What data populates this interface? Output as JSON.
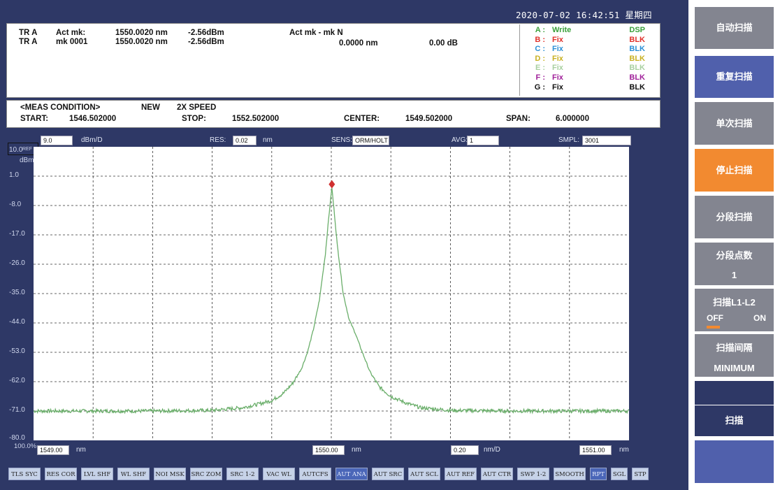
{
  "datetime": "2020-07-02 16:42:51 星期四",
  "markers": {
    "rows": [
      {
        "trace": "TR A",
        "label": "Act mk:",
        "wl": "1550.0020 nm",
        "level": "-2.56dBm"
      },
      {
        "trace": "TR A",
        "label": "mk 0001",
        "wl": "1550.0020 nm",
        "level": "-2.56dBm"
      }
    ],
    "delta_label": "Act mk - mk N",
    "delta_wl": "0.0000 nm",
    "delta_db": "0.00 dB"
  },
  "traces": [
    {
      "key": "A :",
      "mode": "Write",
      "disp": "DSP",
      "color": "#3aa03a"
    },
    {
      "key": "B :",
      "mode": "Fix",
      "disp": "BLK",
      "color": "#e0302a"
    },
    {
      "key": "C :",
      "mode": "Fix",
      "disp": "BLK",
      "color": "#2a8fd6"
    },
    {
      "key": "D :",
      "mode": "Fix",
      "disp": "BLK",
      "color": "#c8b020"
    },
    {
      "key": "E :",
      "mode": "Fix",
      "disp": "BLK",
      "color": "#a8d0a0"
    },
    {
      "key": "F :",
      "mode": "Fix",
      "disp": "BLK",
      "color": "#a0209a"
    },
    {
      "key": "G :",
      "mode": "Fix",
      "disp": "BLK",
      "color": "#111111"
    }
  ],
  "meas": {
    "title": "<MEAS CONDITION>",
    "new": "NEW",
    "speed": "2X SPEED",
    "start_label": "START:",
    "start": "1546.502000",
    "stop_label": "STOP:",
    "stop": "1552.502000",
    "center_label": "CENTER:",
    "center": "1549.502000",
    "span_label": "SPAN:",
    "span": "6.000000"
  },
  "settings": {
    "scale": "9.0",
    "scale_unit": "dBm/D",
    "res_label": "RES:",
    "res": "0.02",
    "res_unit": "nm",
    "sens_label": "SENS:",
    "sens": "ORM/HOLT",
    "avg_label": "AVG:",
    "avg": "1",
    "smpl_label": "SMPL:",
    "smpl": "3001"
  },
  "ref": {
    "value": "10.0",
    "suffix": "REF",
    "unit": "dBm"
  },
  "x_axis": {
    "left": "1549.00",
    "center": "1550.00",
    "right": "1551.00",
    "unit": "nm",
    "div": "0.20",
    "div_unit": "nm/D",
    "pct": "100.0%"
  },
  "chart_data": {
    "type": "line",
    "xlim": [
      1549.0,
      1551.0
    ],
    "ylim": [
      -80.0,
      10.0
    ],
    "grid": true,
    "ytick_labels": [
      "10.0",
      "1.0",
      "-8.0",
      "-17.0",
      "-26.0",
      "-35.0",
      "-44.0",
      "-53.0",
      "-62.0",
      "-71.0",
      "-80.0"
    ],
    "series": [
      {
        "color": "#6aae6a",
        "x": [
          1549.0,
          1549.2,
          1549.4,
          1549.6,
          1549.7,
          1549.75,
          1549.8,
          1549.84,
          1549.87,
          1549.9,
          1549.92,
          1549.94,
          1549.96,
          1549.98,
          1549.99,
          1550.0,
          1550.002,
          1550.01,
          1550.02,
          1550.04,
          1550.06,
          1550.08,
          1550.1,
          1550.13,
          1550.16,
          1550.2,
          1550.25,
          1550.3,
          1550.4,
          1550.6,
          1550.8,
          1551.0
        ],
        "y": [
          -71.0,
          -71.0,
          -71.0,
          -70.8,
          -70.0,
          -69.0,
          -67.8,
          -65.5,
          -62.5,
          -58.0,
          -53.0,
          -46.0,
          -37.0,
          -23.0,
          -13.0,
          -4.0,
          -2.56,
          -10.0,
          -20.0,
          -35.0,
          -43.0,
          -47.0,
          -52.0,
          -59.0,
          -63.5,
          -66.5,
          -68.5,
          -70.0,
          -70.8,
          -71.0,
          -71.0,
          -71.0
        ]
      }
    ],
    "marker": {
      "x": 1550.002,
      "y": -2.56,
      "color": "#d03030"
    }
  },
  "func_buttons": [
    {
      "label": "TLS SYC",
      "on": false
    },
    {
      "label": "RES COR",
      "on": false
    },
    {
      "label": "LVL SHF",
      "on": false
    },
    {
      "label": "WL SHF",
      "on": false
    },
    {
      "label": "NOI MSK",
      "on": false
    },
    {
      "label": "SRC ZOM",
      "on": false
    },
    {
      "label": "SRC 1-2",
      "on": false
    },
    {
      "label": "VAC WL",
      "on": false
    },
    {
      "label": "AUTCFS",
      "on": false
    },
    {
      "label": "AUT ANA",
      "on": true
    },
    {
      "label": "AUT SRC",
      "on": false
    },
    {
      "label": "AUT SCL",
      "on": false
    },
    {
      "label": "AUT REF",
      "on": false
    },
    {
      "label": "AUT CTR",
      "on": false
    },
    {
      "label": "SWP 1-2",
      "on": false
    },
    {
      "label": "SMOOTH",
      "on": false
    },
    {
      "label": "RPT",
      "on": true
    },
    {
      "label": "SGL",
      "on": false
    },
    {
      "label": "STP",
      "on": false
    }
  ],
  "softkeys": {
    "auto": "自动扫描",
    "repeat": "重复扫描",
    "single": "单次扫描",
    "stop": "停止扫描",
    "segment": "分段扫描",
    "seg_points_title": "分段点数",
    "seg_points_value": "1",
    "l1l2_title": "扫描L1-L2",
    "l1l2_off": "OFF",
    "l1l2_on": "ON",
    "interval_title": "扫描间隔",
    "interval_value": "MINIMUM",
    "sweep": "扫描"
  }
}
